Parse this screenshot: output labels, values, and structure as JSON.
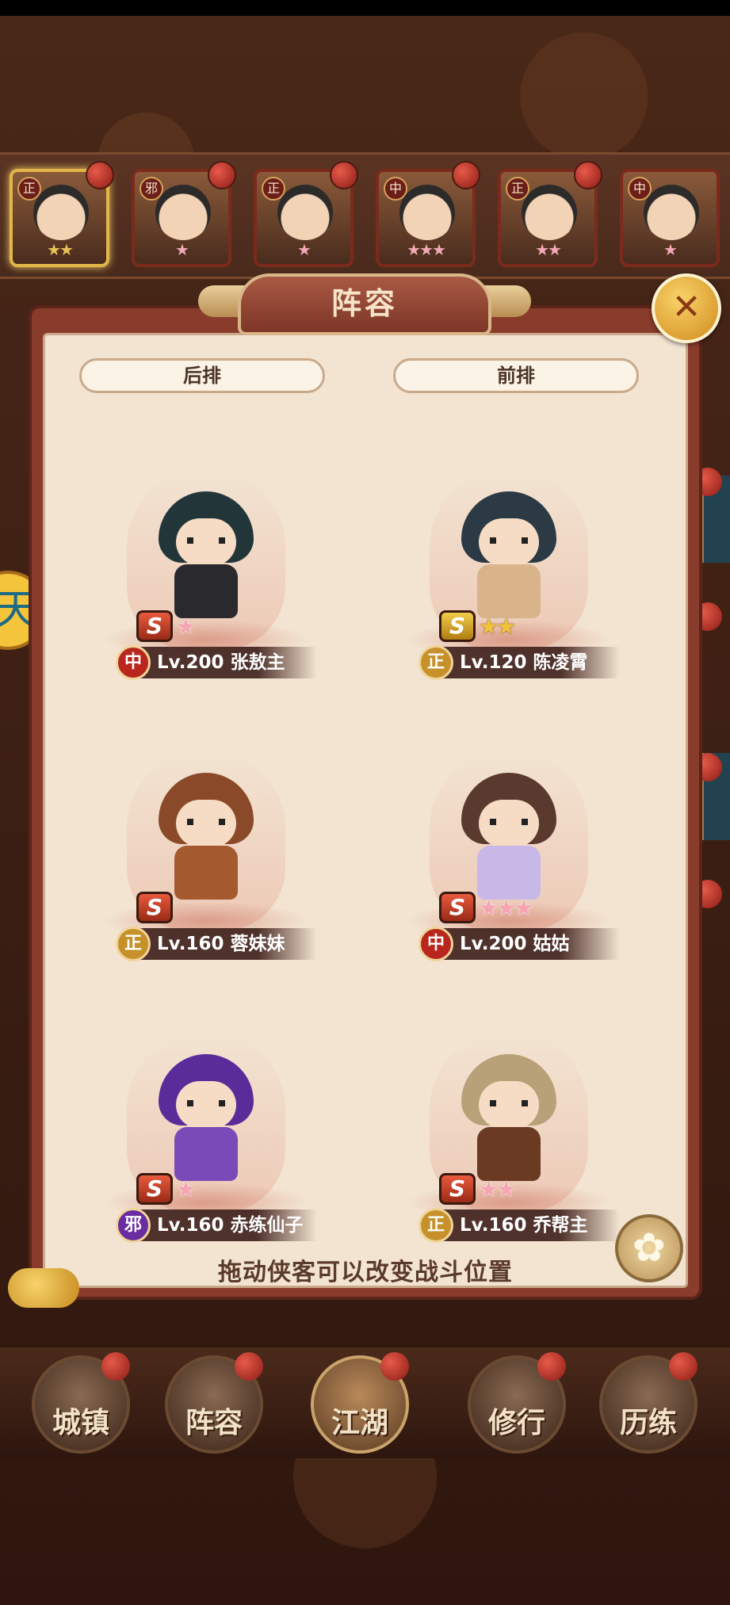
{
  "panel": {
    "title": "阵容",
    "back_row_label": "后排",
    "front_row_label": "前排",
    "hint": "拖动侠客可以改变战斗位置"
  },
  "hero_strip": [
    {
      "faction": "正",
      "stars": "★★",
      "star_color": "gold",
      "selected": true
    },
    {
      "faction": "邪",
      "stars": "★",
      "star_color": "pink",
      "selected": false
    },
    {
      "faction": "正",
      "stars": "★",
      "star_color": "pink",
      "selected": false
    },
    {
      "faction": "中",
      "stars": "★★★",
      "star_color": "pink",
      "selected": false
    },
    {
      "faction": "正",
      "stars": "★★",
      "star_color": "pink",
      "selected": false
    },
    {
      "faction": "中",
      "stars": "★",
      "star_color": "pink",
      "selected": false
    }
  ],
  "lineup": [
    {
      "row": "后排",
      "sect": "中",
      "level": "Lv.200",
      "name": "张敖主",
      "grade": "S",
      "stars": "★",
      "star_color": "pink"
    },
    {
      "row": "前排",
      "sect": "正",
      "level": "Lv.120",
      "name": "陈凌霄",
      "grade": "S",
      "stars": "★★",
      "star_color": "gold"
    },
    {
      "row": "后排",
      "sect": "正",
      "level": "Lv.160",
      "name": "蓉妹妹",
      "grade": "S",
      "stars": "",
      "star_color": "pink"
    },
    {
      "row": "前排",
      "sect": "中",
      "level": "Lv.200",
      "name": "姑姑",
      "grade": "S",
      "stars": "★★★",
      "star_color": "pink"
    },
    {
      "row": "后排",
      "sect": "邪",
      "level": "Lv.160",
      "name": "赤练仙子",
      "grade": "S",
      "stars": "★",
      "star_color": "pink"
    },
    {
      "row": "前排",
      "sect": "正",
      "level": "Lv.160",
      "name": "乔帮主",
      "grade": "S",
      "stars": "★★",
      "star_color": "pink"
    }
  ],
  "bottom_nav": [
    {
      "label": "城镇"
    },
    {
      "label": "阵容"
    },
    {
      "label": "江湖"
    },
    {
      "label": "修行"
    },
    {
      "label": "历练"
    }
  ],
  "side_badge": "天",
  "colors": {
    "panel_bg": "#f3e4d2",
    "frame": "#8a3c2c",
    "accent_gold": "#f0c33a",
    "sect_zhong": "#b8261e",
    "sect_zheng": "#c6912a",
    "sect_xie": "#6a2ca0"
  }
}
